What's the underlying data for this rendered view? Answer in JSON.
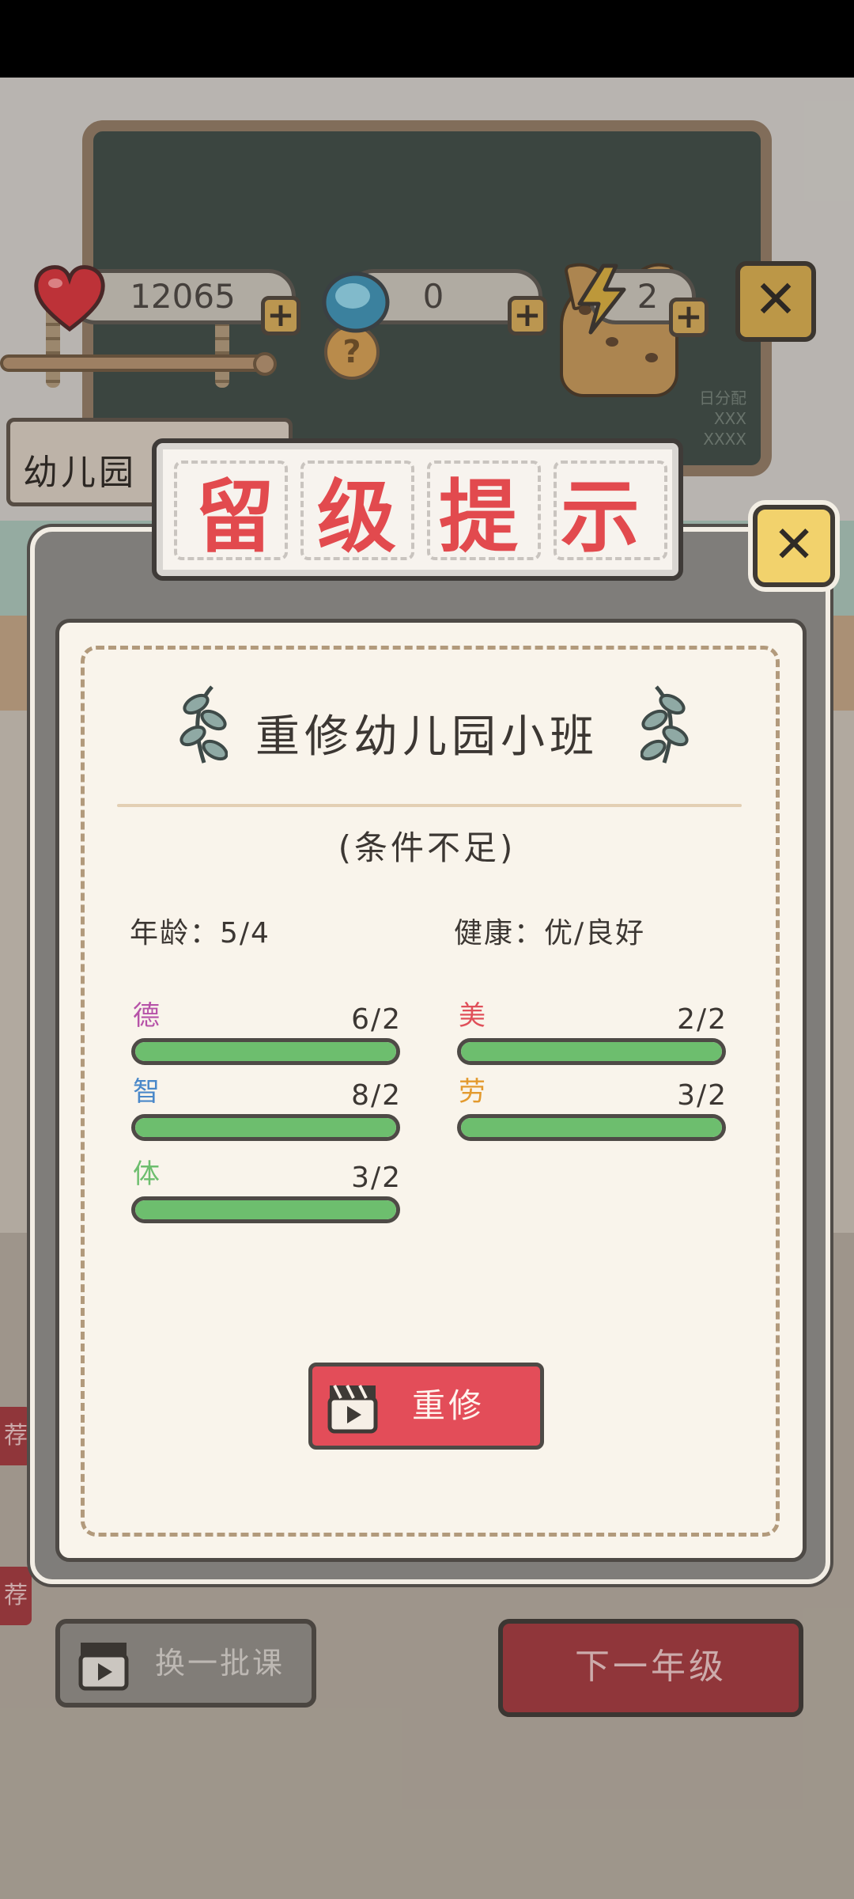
{
  "resources": {
    "hearts": "12065",
    "gems": "0",
    "energy": "2"
  },
  "colors": {
    "accent_red": "#e24a4e",
    "button_red": "#e34d59",
    "progress_green": "#6dbe6e",
    "stat_de": "#b652a8",
    "stat_zhi": "#4a88c9",
    "stat_ti": "#6dbe6e",
    "stat_mei": "#e0505a",
    "stat_lao": "#e39a2e"
  },
  "background": {
    "sign_text": "幼儿园",
    "board_note_1": "日分配",
    "board_note_2": "XXX",
    "board_note_3": "XXXX",
    "help_label": "?",
    "side_tag_1": "荐",
    "side_tag_2": "荐",
    "swap_button": "换一批课",
    "next_grade_button": "下一年级"
  },
  "modal": {
    "title_chars": [
      "留",
      "级",
      "提",
      "示"
    ],
    "subtitle": "重修幼儿园小班",
    "condition": "(条件不足)",
    "age": "年龄：5/4",
    "health": "健康：优/良好",
    "stats": [
      {
        "name": "德",
        "value": "6/2",
        "progress": 1.0
      },
      {
        "name": "美",
        "value": "2/2",
        "progress": 1.0
      },
      {
        "name": "智",
        "value": "8/2",
        "progress": 1.0
      },
      {
        "name": "劳",
        "value": "3/2",
        "progress": 1.0
      },
      {
        "name": "体",
        "value": "3/2",
        "progress": 1.0
      }
    ],
    "retake_button": "重修"
  },
  "icons": [
    "heart-icon",
    "gem-icon",
    "lightning-icon",
    "close-icon",
    "clapperboard-icon",
    "leaf-icon"
  ]
}
